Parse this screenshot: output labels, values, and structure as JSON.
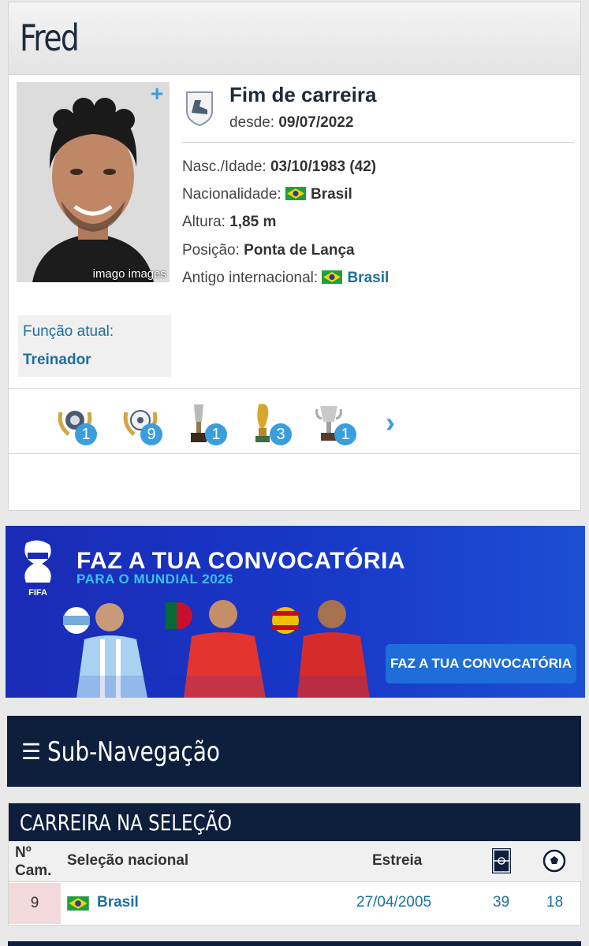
{
  "player": {
    "name": "Fred",
    "photo_credit": "imago images"
  },
  "status": {
    "title": "Fim de carreira",
    "since_label": "desde:",
    "since_date": "09/07/2022"
  },
  "info": {
    "birth_label": "Nasc./Idade:",
    "birth_value": "03/10/1983 (42)",
    "nationality_label": "Nacionalidade:",
    "nationality_value": "Brasil",
    "height_label": "Altura:",
    "height_value": "1,85 m",
    "position_label": "Posição:",
    "position_value": "Ponta de Lança",
    "intl_label": "Antigo internacional:",
    "intl_value": "Brasil"
  },
  "function": {
    "label": "Função atual:",
    "value": "Treinador"
  },
  "trophies": [
    {
      "icon": "laurel-trophy-icon",
      "count": "1"
    },
    {
      "icon": "laurel-ball-trophy-icon",
      "count": "9"
    },
    {
      "icon": "cup-trophy-icon",
      "count": "1"
    },
    {
      "icon": "gold-cup-trophy-icon",
      "count": "3"
    },
    {
      "icon": "silver-cup-trophy-icon",
      "count": "1"
    }
  ],
  "banner": {
    "logo_text": "FIFA",
    "title": "FAZ A TUA CONVOCATÓRIA",
    "subtitle": "PARA O MUNDIAL 2026",
    "cta": "FAZ A TUA CONVOCATÓRIA"
  },
  "subnav": {
    "label": "Sub-Navegação"
  },
  "career": {
    "title": "CARREIRA NA SELEÇÃO",
    "headers": {
      "caps_line1": "Nº",
      "caps_line2": "Cam.",
      "team": "Seleção nacional",
      "debut": "Estreia"
    },
    "rows": [
      {
        "number": "9",
        "team": "Brasil",
        "debut": "27/04/2005",
        "appearances": "39",
        "goals": "18"
      }
    ]
  },
  "colors": {
    "navy": "#0e1e3d",
    "link": "#1d6fa0",
    "accent": "#3a9ddd",
    "banner": "#1a2bb5"
  }
}
